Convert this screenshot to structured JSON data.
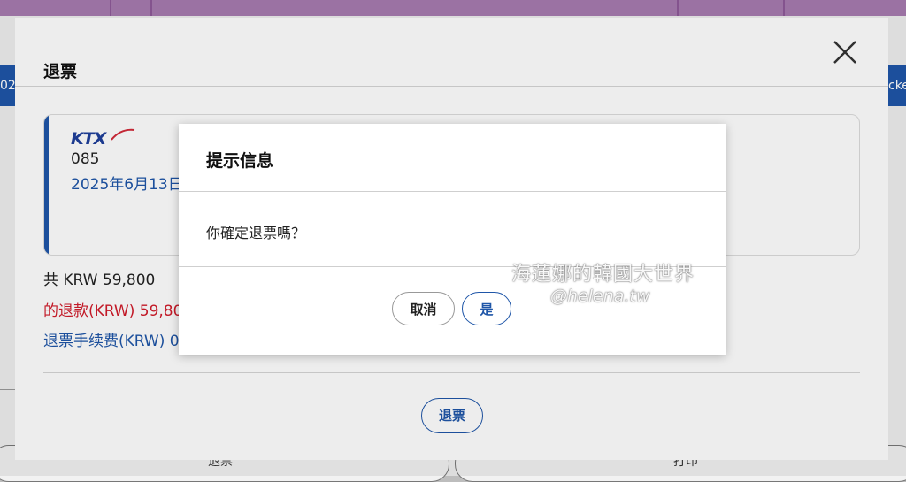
{
  "background": {
    "left_edge_text": "02",
    "right_edge_text": "cke",
    "bottom_left_button": "退票",
    "bottom_right_button": "打印"
  },
  "outer_modal": {
    "title": "退票",
    "close_icon": "close-icon",
    "ticket": {
      "logo": "KTX",
      "train_number": "085",
      "date": "2025年6月13日(星"
    },
    "total": "共 KRW 59,800",
    "refund_amount": "的退款(KRW) 59,800",
    "refund_fee": "退票手续费(KRW) 0",
    "refund_button": "退票"
  },
  "dialog": {
    "title": "提示信息",
    "message": "你確定退票嗎？",
    "cancel_label": "取消",
    "confirm_label": "是"
  },
  "watermark": {
    "line1": "海蓮娜的韓國大世界",
    "line2": "@helena.tw"
  },
  "colors": {
    "brand_blue": "#1f56a8",
    "refund_red": "#d11b2a",
    "top_bar": "#a77bb0"
  }
}
